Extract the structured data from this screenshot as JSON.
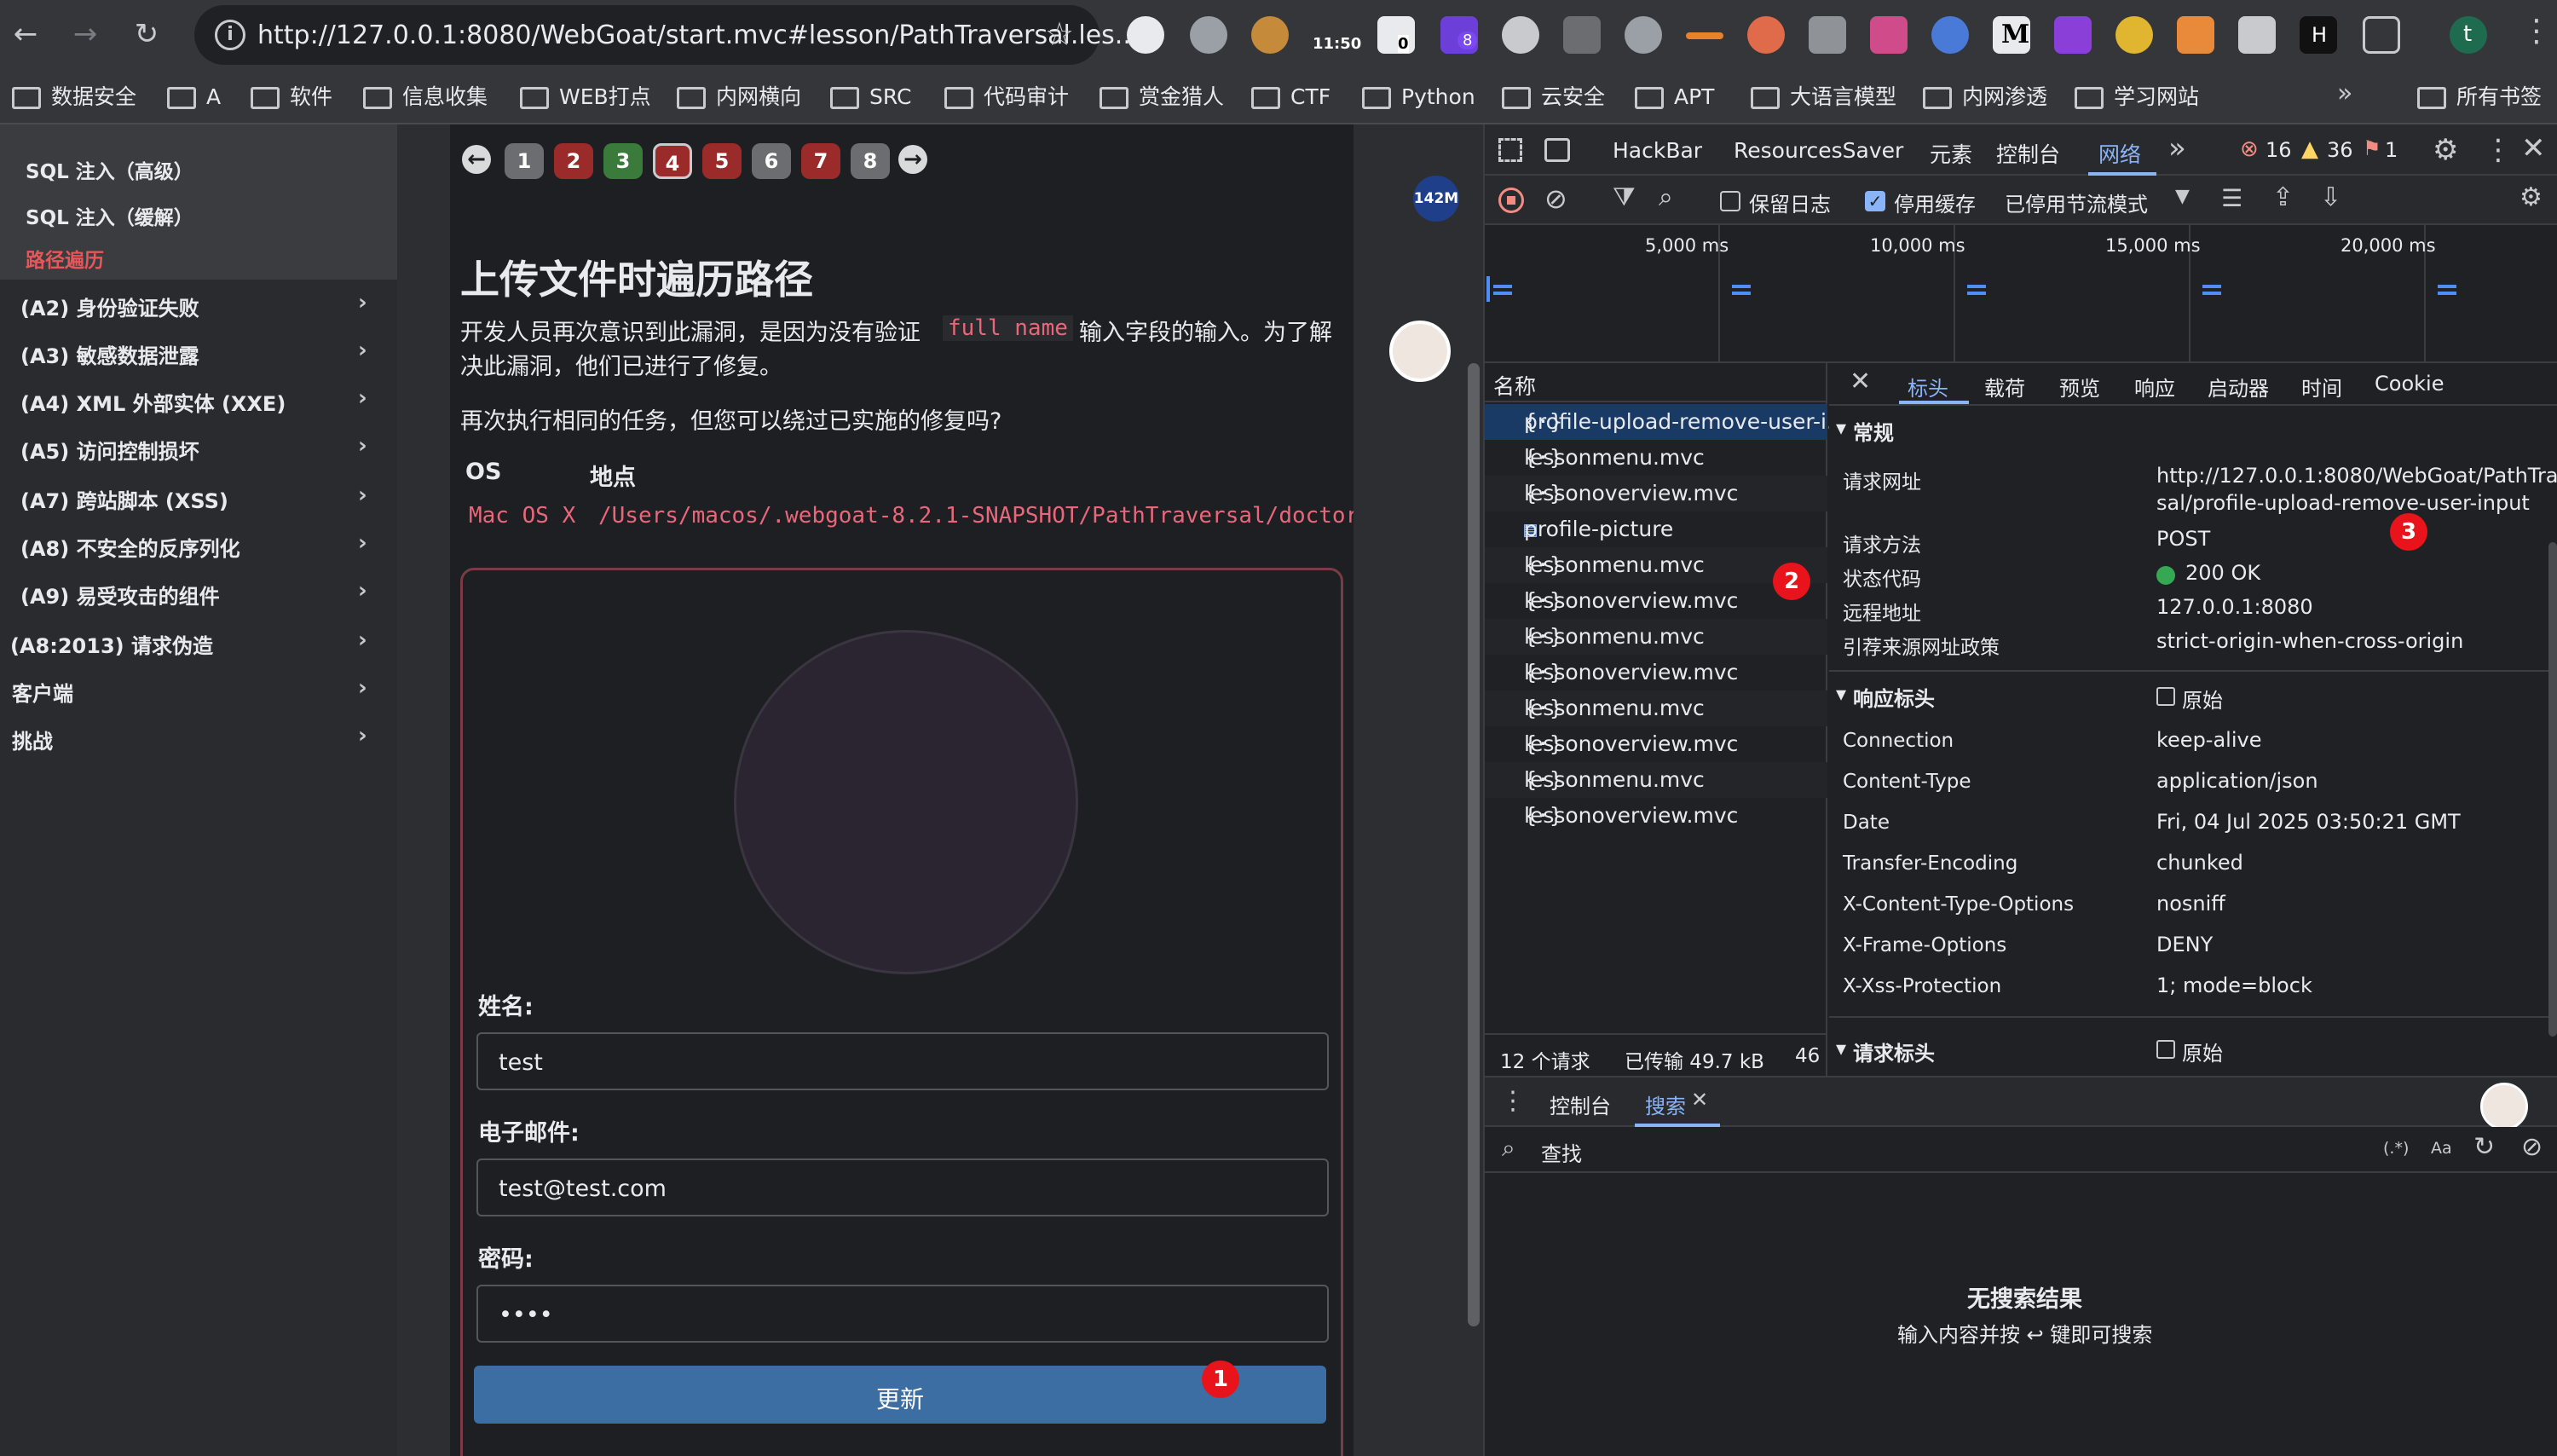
{
  "browser": {
    "url": "http://127.0.0.1:8080/WebGoat/start.mvc#lesson/PathTraversal.les...",
    "ext_time": "11:50",
    "ext_count": "0",
    "ext_badge": "8",
    "ext_letter_m": "M",
    "ext_letter_h": "H",
    "profile_letter": "t",
    "bookmarks": [
      "数据安全",
      "A",
      "软件",
      "信息收集",
      "WEB打点",
      "内网横向",
      "SRC",
      "代码审计",
      "赏金猎人",
      "CTF",
      "Python",
      "云安全",
      "APT",
      "大语言模型",
      "内网渗透",
      "学习网站"
    ],
    "all_bookmarks": "所有书签"
  },
  "sidebar": {
    "sub_items": [
      "SQL 注入（高级）",
      "SQL 注入（缓解）",
      "路径遍历"
    ],
    "items": [
      "(A2) 身份验证失败",
      "(A3) 敏感数据泄露",
      "(A4) XML 外部实体 (XXE)",
      "(A5) 访问控制损坏",
      "(A7) 跨站脚本 (XSS)",
      "(A8) 不安全的反序列化",
      "(A9) 易受攻击的组件",
      "(A8:2013) 请求伪造",
      "客户端",
      "挑战"
    ]
  },
  "lesson": {
    "pages": [
      "1",
      "2",
      "3",
      "4",
      "5",
      "6",
      "7",
      "8"
    ],
    "title": "上传文件时遍历路径",
    "para1_a": "开发人员再次意识到此漏洞，是因为没有验证",
    "para1_code": "full name",
    "para1_b": "输入字段的输入。为了解",
    "para1_c": "决此漏洞，他们已进行了修复。",
    "para2": "再次执行相同的任务，但您可以绕过已实施的修复吗?",
    "os_header": "OS",
    "loc_header": "地点",
    "os_value": "Mac OS X",
    "loc_value": "/Users/macos/.webgoat-8.2.1-SNAPSHOT/PathTraversal/doctor",
    "name_label": "姓名:",
    "name_value": "test",
    "email_label": "电子邮件:",
    "email_value": "test@test.com",
    "password_label": "密码:",
    "password_value": "••••",
    "submit_label": "更新",
    "mem_badge": "142M"
  },
  "markers": [
    "1",
    "2",
    "3"
  ],
  "devtools": {
    "tabs": [
      "HackBar",
      "ResourcesSaver",
      "元素",
      "控制台",
      "网络"
    ],
    "errors": "16",
    "warnings": "36",
    "issues": "1",
    "preserve_log": "保留日志",
    "disable_cache": "停用缓存",
    "throttle": "已停用节流模式",
    "timeline_labels": [
      "5,000 ms",
      "10,000 ms",
      "15,000 ms",
      "20,000 ms"
    ],
    "name_header": "名称",
    "requests": [
      "profile-upload-remove-user-i...",
      "lessonmenu.mvc",
      "lessonoverview.mvc",
      "profile-picture",
      "lessonmenu.mvc",
      "lessonoverview.mvc",
      "lessonmenu.mvc",
      "lessonoverview.mvc",
      "lessonmenu.mvc",
      "lessonoverview.mvc",
      "lessonmenu.mvc",
      "lessonoverview.mvc"
    ],
    "status_bar": [
      "12 个请求",
      "已传输 49.7 kB",
      "46"
    ],
    "detail_tabs": [
      "标头",
      "载荷",
      "预览",
      "响应",
      "启动器",
      "时间",
      "Cookie"
    ],
    "general_header": "常规",
    "general": [
      {
        "k": "请求网址",
        "v": "http://127.0.0.1:8080/WebGoat/PathTraver"
      },
      {
        "k": "请求方法",
        "v": "POST"
      },
      {
        "k": "状态代码",
        "v": "200 OK"
      },
      {
        "k": "远程地址",
        "v": "127.0.0.1:8080"
      },
      {
        "k": "引荐来源网址政策",
        "v": "strict-origin-when-cross-origin"
      }
    ],
    "url_cont": "sal/profile-upload-remove-user-input",
    "response_header": "响应标头",
    "raw_label": "原始",
    "response": [
      {
        "k": "Connection",
        "v": "keep-alive"
      },
      {
        "k": "Content-Type",
        "v": "application/json"
      },
      {
        "k": "Date",
        "v": "Fri, 04 Jul 2025 03:50:21 GMT"
      },
      {
        "k": "Transfer-Encoding",
        "v": "chunked"
      },
      {
        "k": "X-Content-Type-Options",
        "v": "nosniff"
      },
      {
        "k": "X-Frame-Options",
        "v": "DENY"
      },
      {
        "k": "X-Xss-Protection",
        "v": "1; mode=block"
      }
    ],
    "request_header": "请求标头",
    "drawer_tabs": [
      "控制台",
      "搜索"
    ],
    "search_placeholder": "查找",
    "regex": "(.*)",
    "case": "Aa",
    "no_results": "无搜索结果",
    "no_results_hint": "输入内容并按 ↩ 键即可搜索"
  }
}
